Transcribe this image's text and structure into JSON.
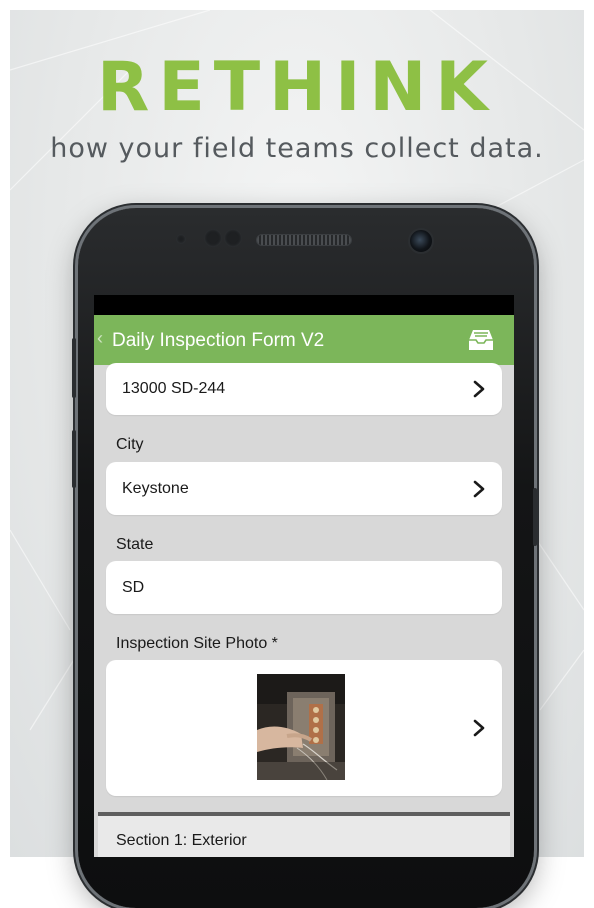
{
  "hero": {
    "headline": "RETHINK",
    "tagline": "how your field teams collect data.",
    "headline_color": "#8ec045",
    "tagline_color": "#555a5e"
  },
  "app": {
    "title": "Daily Inspection Form V2",
    "appbar_color": "#7cb65a",
    "back_icon": "chevron-left-icon",
    "action_icon": "inbox-tray-icon"
  },
  "form": {
    "address_value": "13000 SD-244",
    "city_label": "City",
    "city_value": "Keystone",
    "state_label": "State",
    "state_value": "SD",
    "photo_label": "Inspection Site Photo *",
    "section_title": "Section 1: Exterior"
  }
}
